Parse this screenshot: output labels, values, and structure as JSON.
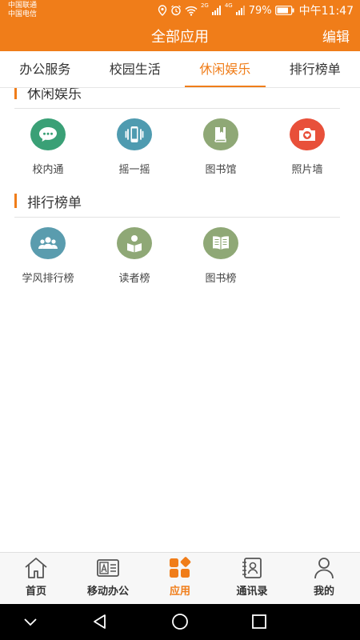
{
  "status": {
    "carrier1": "中国联通",
    "carrier2": "中国电信",
    "signal1": "2G",
    "signal2": "4G",
    "battery": "79%",
    "time": "中午11:47"
  },
  "header": {
    "title": "全部应用",
    "edit": "编辑"
  },
  "tabs": [
    {
      "label": "办公服务"
    },
    {
      "label": "校园生活"
    },
    {
      "label": "休闲娱乐"
    },
    {
      "label": "排行榜单"
    }
  ],
  "sections": {
    "leisure": {
      "title": "休闲娱乐",
      "apps": [
        {
          "name": "校内通",
          "color": "#3aa076",
          "icon": "chat-icon"
        },
        {
          "name": "摇一摇",
          "color": "#4f9bb0",
          "icon": "shake-phone-icon"
        },
        {
          "name": "图书馆",
          "color": "#8fa876",
          "icon": "book-icon"
        },
        {
          "name": "照片墙",
          "color": "#e8503a",
          "icon": "camera-heart-icon"
        }
      ]
    },
    "ranking": {
      "title": "排行榜单",
      "apps": [
        {
          "name": "学风排行榜",
          "color": "#5a9cae",
          "icon": "people-icon"
        },
        {
          "name": "读者榜",
          "color": "#8fa876",
          "icon": "reader-icon"
        },
        {
          "name": "图书榜",
          "color": "#8fa876",
          "icon": "open-book-icon"
        }
      ]
    }
  },
  "bottom_nav": [
    {
      "label": "首页",
      "icon": "home-icon"
    },
    {
      "label": "移动办公",
      "icon": "id-card-icon"
    },
    {
      "label": "应用",
      "icon": "apps-icon"
    },
    {
      "label": "通讯录",
      "icon": "contacts-icon"
    },
    {
      "label": "我的",
      "icon": "person-icon"
    }
  ],
  "colors": {
    "accent": "#f07d19",
    "text": "#333333"
  }
}
